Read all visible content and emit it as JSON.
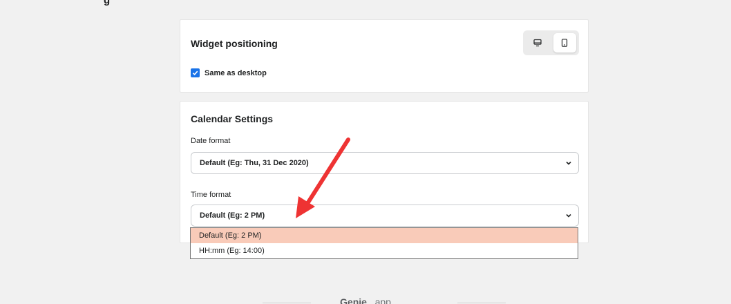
{
  "page": {
    "heading_clip": "g"
  },
  "widget_positioning": {
    "title": "Widget positioning",
    "same_as_desktop_label": "Same as desktop",
    "same_as_desktop_checked": true,
    "device_toggle": {
      "options": [
        "desktop",
        "mobile"
      ],
      "active": "mobile"
    }
  },
  "calendar_settings": {
    "title": "Calendar Settings",
    "date_format": {
      "label": "Date format",
      "value": "Default (Eg: Thu, 31 Dec 2020)"
    },
    "time_format": {
      "label": "Time format",
      "value": "Default (Eg: 2 PM)",
      "options": [
        "Default (Eg: 2 PM)",
        "HH:mm (Eg: 14:00)"
      ],
      "highlighted_index": 0
    }
  },
  "footer": {
    "brand": "Genie",
    "suffix": " . app"
  },
  "colors": {
    "accent": "#1a73e8",
    "highlight": "#f9cbb9",
    "annotation_arrow": "#ee3333"
  }
}
